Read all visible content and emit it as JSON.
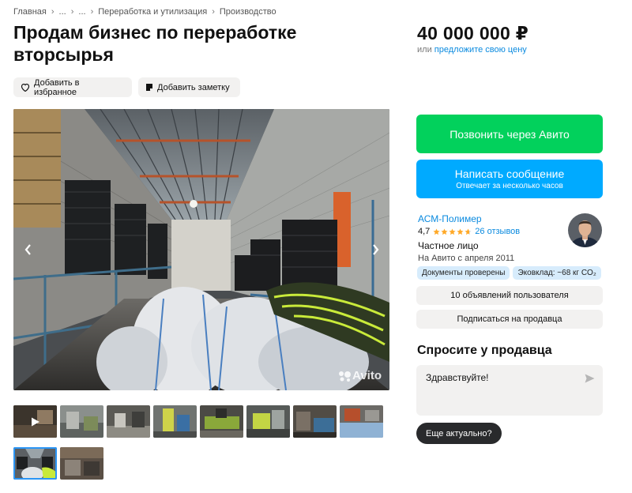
{
  "breadcrumb": {
    "items": [
      "Главная",
      "...",
      "...",
      "Переработка и утилизация",
      "Производство"
    ]
  },
  "title": "Продам бизнес по переработке вторсырья",
  "price": {
    "value": "40 000 000 ₽",
    "prefix": "или",
    "offer_link": "предложите свою цену"
  },
  "actions": {
    "favorite": "Добавить в избранное",
    "note": "Добавить заметку"
  },
  "gallery": {
    "watermark": "Avito",
    "thumbnail_count": 10,
    "selected_index": 8
  },
  "contact": {
    "call": "Позвонить через Авито",
    "message": "Написать сообщение",
    "message_sub": "Отвечает за несколько часов"
  },
  "seller": {
    "name": "АСМ-Полимер",
    "rating": "4,7",
    "stars": 4.7,
    "reviews": "26 отзывов",
    "type": "Частное лицо",
    "since": "На Авито с апреля 2011",
    "badges": [
      "Документы проверены",
      "Эковклад: ~68 кг CO₂"
    ],
    "listings": "10 объявлений пользователя",
    "subscribe": "Подписаться на продавца"
  },
  "ask": {
    "title": "Спросите у продавца",
    "message": "Здравствуйте!",
    "quick_reply": "Еще актуально?"
  },
  "colors": {
    "green": "#02d15c",
    "blue": "#00aaff",
    "link": "#0a8adf",
    "star": "#ffa928"
  }
}
